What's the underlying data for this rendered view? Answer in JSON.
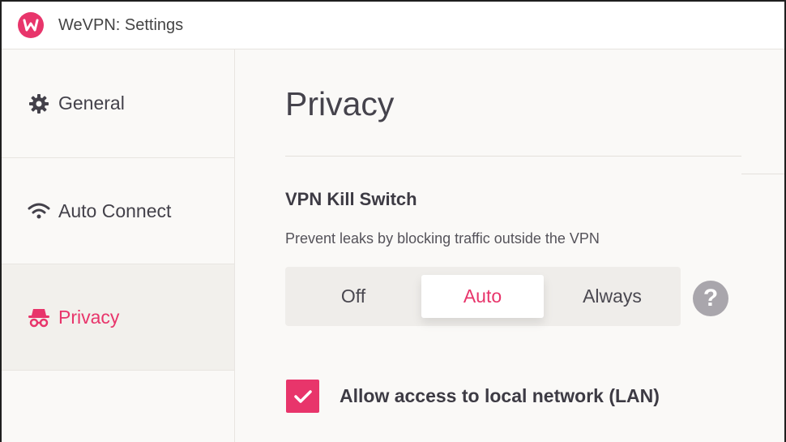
{
  "window": {
    "title": "WeVPN: Settings"
  },
  "sidebar": {
    "items": [
      {
        "label": "General",
        "icon": "gear-icon",
        "active": false
      },
      {
        "label": "Auto Connect",
        "icon": "wifi-icon",
        "active": false
      },
      {
        "label": "Privacy",
        "icon": "spy-icon",
        "active": true
      }
    ]
  },
  "main": {
    "title": "Privacy",
    "kill_switch": {
      "title": "VPN Kill Switch",
      "description": "Prevent leaks by blocking traffic outside the VPN",
      "options": [
        "Off",
        "Auto",
        "Always"
      ],
      "selected": "Auto",
      "help_label": "?"
    },
    "lan": {
      "label": "Allow access to local network (LAN)",
      "checked": true
    }
  },
  "colors": {
    "accent": "#e8356b",
    "background": "#faf9f7"
  }
}
